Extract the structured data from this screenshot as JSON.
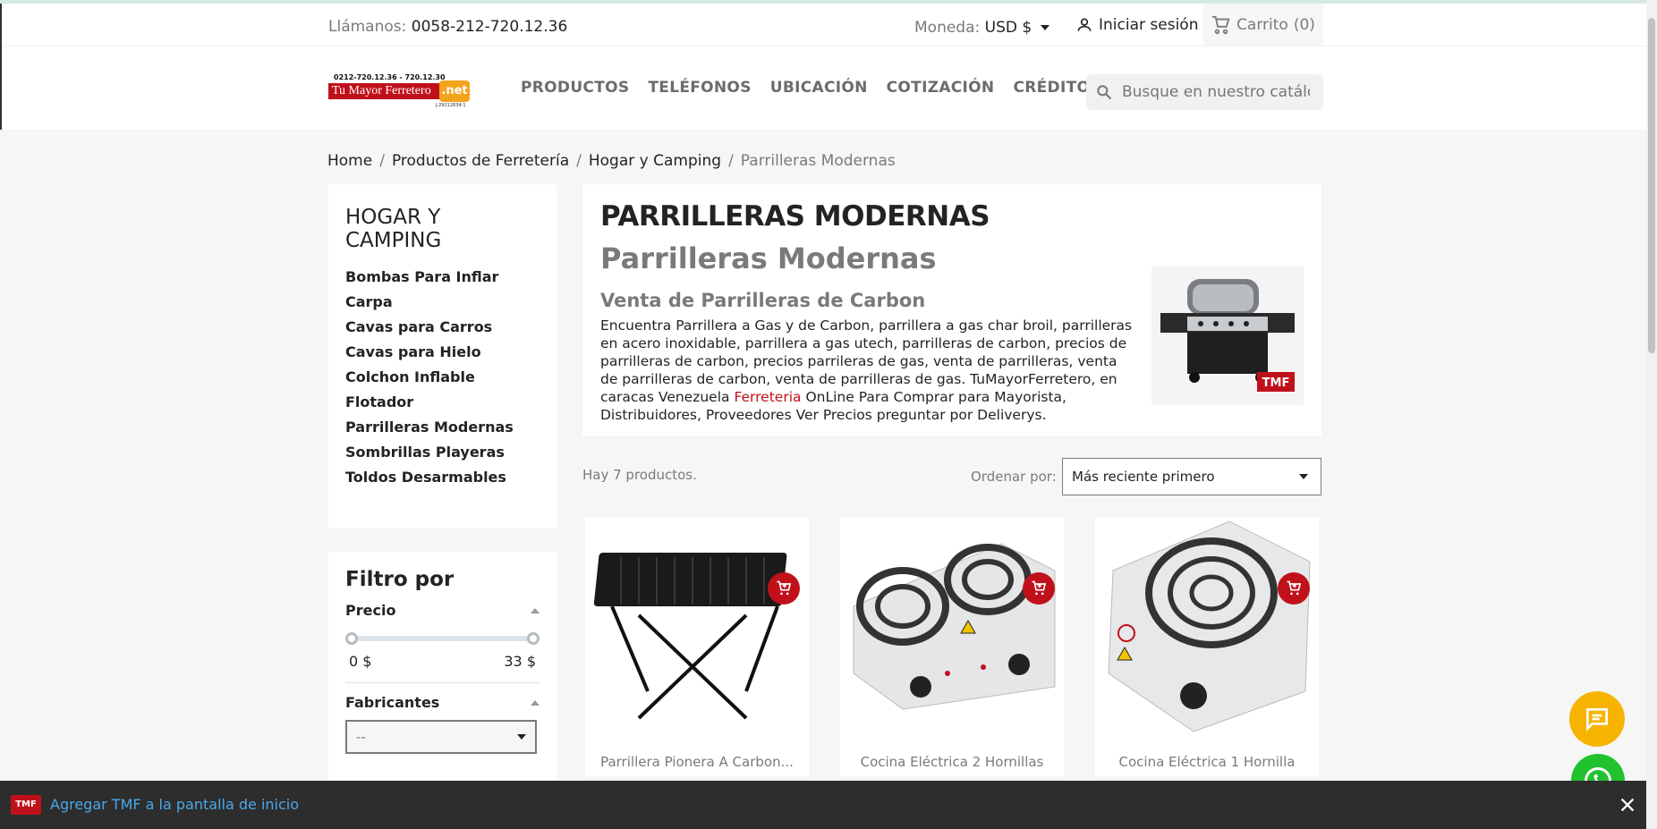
{
  "header": {
    "contact_label": "Llámanos:",
    "contact_phone": "0058-212-720.12.36",
    "currency_label": "Moneda:",
    "currency_value": "USD $",
    "login_label": "Iniciar sesión",
    "cart_label": "Carrito",
    "cart_count": "(0)",
    "logo": {
      "tel": "0212-720.12.36 - 720.12.30",
      "brand": "Tu Mayor Ferretero",
      "net": ".net",
      "rif": "J-29212834-1"
    },
    "menu": [
      "PRODUCTOS",
      "TELÉFONOS",
      "UBICACIÓN",
      "COTIZACIÓN",
      "CRÉDITO"
    ],
    "search_placeholder": "Busque en nuestro catálogo"
  },
  "breadcrumb": [
    "Home",
    "Productos de Ferretería",
    "Hogar y Camping",
    "Parrilleras Modernas"
  ],
  "sidebar": {
    "title": "HOGAR Y CAMPING",
    "categories": [
      "Bombas Para Inflar",
      "Carpa",
      "Cavas para Carros",
      "Cavas para Hielo",
      "Colchon Inflable",
      "Flotador",
      "Parrilleras Modernas",
      "Sombrillas Playeras",
      "Toldos Desarmables"
    ],
    "filter_title": "Filtro por",
    "price_label": "Precio",
    "price_min": "0 $",
    "price_max": "33 $",
    "price_range_fraction": [
      0,
      1
    ],
    "manufacturers_label": "Fabricantes",
    "manufacturers_value": "--"
  },
  "main": {
    "h1": "PARRILLERAS MODERNAS",
    "h2": "Parrilleras Modernas",
    "h3": "Venta de Parrilleras de Carbon",
    "desc_part1": "Encuentra Parrillera a Gas y de Carbon, parrillera a gas char broil, parrilleras en acero inoxidable, parrillera a gas utech, parrilleras de carbon, precios de parrilleras de carbon, precios parrileras de gas, venta de parrilleras, venta de parrilleras de carbon, venta de parrilleras de gas. TuMayorFerretero, en caracas Venezuela ",
    "desc_link": "Ferreteria",
    "desc_part2": " OnLine Para Comprar para Mayorista, Distribuidores, Proveedores Ver Precios preguntar por Deliverys.",
    "image_badge": "TMF",
    "product_count": "Hay 7 productos.",
    "sort_label": "Ordenar por:",
    "sort_value": "Más reciente primero",
    "products": [
      {
        "name": "Parrillera Pionera A Carbon..."
      },
      {
        "name": "Cocina Eléctrica 2 Hornillas"
      },
      {
        "name": "Cocina Eléctrica 1 Hornilla"
      }
    ]
  },
  "a2hs": {
    "badge": "TMF",
    "text": "Agregar TMF a la pantalla de inicio"
  },
  "colors": {
    "brand_red": "#c0111b",
    "whatsapp_green": "#22c22e",
    "chat_yellow": "#f6b400",
    "link_blue": "#4aa8e8"
  }
}
